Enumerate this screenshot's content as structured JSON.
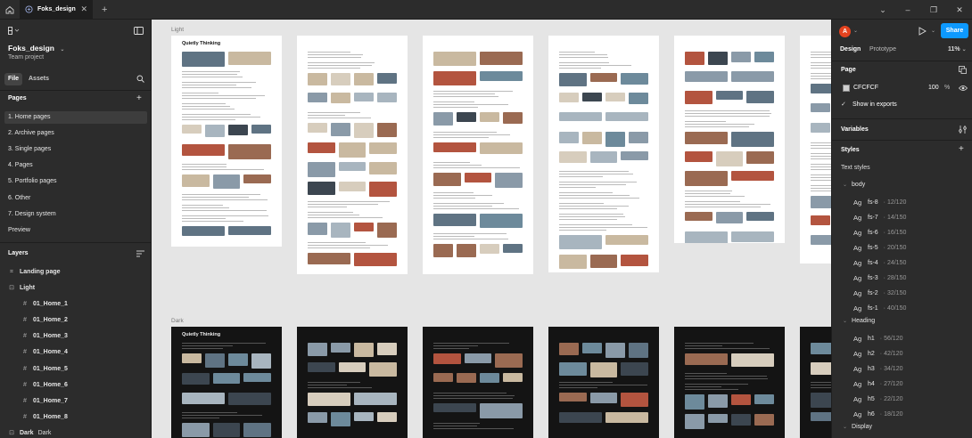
{
  "tabbar": {
    "file_tab": "Foks_design",
    "close_glyph": "✕",
    "new_tab_glyph": "+",
    "window_controls": [
      "⌄",
      "–",
      "❐",
      "✕"
    ]
  },
  "left": {
    "project_name": "Foks_design",
    "project_type": "Team project",
    "tabs": [
      "File",
      "Assets"
    ],
    "pages_header": "Pages",
    "pages": [
      "1. Home pages",
      "2. Archive pages",
      "3. Single pages",
      "4. Pages",
      "5. Portfolio pages",
      "6. Other",
      "7. Design system",
      "Preview"
    ],
    "layers_header": "Layers",
    "layers": [
      {
        "name": "Landing page",
        "icon": "grid-icon",
        "glyph": "⌗",
        "indent": 0
      },
      {
        "name": "Light",
        "icon": "section-icon",
        "glyph": "⊡",
        "indent": 0
      },
      {
        "name": "01_Home_1",
        "icon": "frame-icon",
        "glyph": "#",
        "indent": 1
      },
      {
        "name": "01_Home_2",
        "icon": "frame-icon",
        "glyph": "#",
        "indent": 1
      },
      {
        "name": "01_Home_3",
        "icon": "frame-icon",
        "glyph": "#",
        "indent": 1
      },
      {
        "name": "01_Home_4",
        "icon": "frame-icon",
        "glyph": "#",
        "indent": 1
      },
      {
        "name": "01_Home_5",
        "icon": "frame-icon",
        "glyph": "#",
        "indent": 1
      },
      {
        "name": "01_Home_6",
        "icon": "frame-icon",
        "glyph": "#",
        "indent": 1
      },
      {
        "name": "01_Home_7",
        "icon": "frame-icon",
        "glyph": "#",
        "indent": 1
      },
      {
        "name": "01_Home_8",
        "icon": "frame-icon",
        "glyph": "#",
        "indent": 1
      }
    ],
    "last_layer": "Dark",
    "last_layer_tag": "Dark"
  },
  "canvas": {
    "light_label": "Light",
    "dark_label": "Dark",
    "frame_heads": [
      "Quietly Thinking",
      "",
      "",
      "",
      "",
      ""
    ],
    "dark_frame_heads": [
      "Quietly Thinking",
      "",
      "",
      "",
      "",
      ""
    ]
  },
  "right": {
    "avatar_letter": "A",
    "share_label": "Share",
    "tabs": [
      "Design",
      "Prototype"
    ],
    "zoom": "11%",
    "page_header": "Page",
    "page_color": "CFCFCF",
    "page_opacity": "100",
    "percent_sign": "%",
    "show_in_exports": "Show in exports",
    "variables_header": "Variables",
    "styles_header": "Styles",
    "text_styles_label": "Text styles",
    "groups": [
      {
        "name": "body",
        "styles": [
          {
            "name": "fs-8",
            "meta": "· 12/120"
          },
          {
            "name": "fs-7",
            "meta": "· 14/150"
          },
          {
            "name": "fs-6",
            "meta": "· 16/150"
          },
          {
            "name": "fs-5",
            "meta": "· 20/150"
          },
          {
            "name": "fs-4",
            "meta": "· 24/150"
          },
          {
            "name": "fs-3",
            "meta": "· 28/150"
          },
          {
            "name": "fs-2",
            "meta": "· 32/150"
          },
          {
            "name": "fs-1",
            "meta": "· 40/150"
          }
        ]
      },
      {
        "name": "Heading",
        "styles": [
          {
            "name": "h1",
            "meta": "· 56/120"
          },
          {
            "name": "h2",
            "meta": "· 42/120"
          },
          {
            "name": "h3",
            "meta": "· 34/120"
          },
          {
            "name": "h4",
            "meta": "· 27/120"
          },
          {
            "name": "h5",
            "meta": "· 22/120"
          },
          {
            "name": "h6",
            "meta": "· 18/120"
          }
        ]
      },
      {
        "name": "Display",
        "styles": []
      }
    ],
    "ag_glyph": "Ag"
  },
  "colors": {
    "accent": "#0d99ff",
    "avatar": "#e5431f",
    "panel": "#2c2c2c",
    "canvas": "#e5e5e5"
  }
}
